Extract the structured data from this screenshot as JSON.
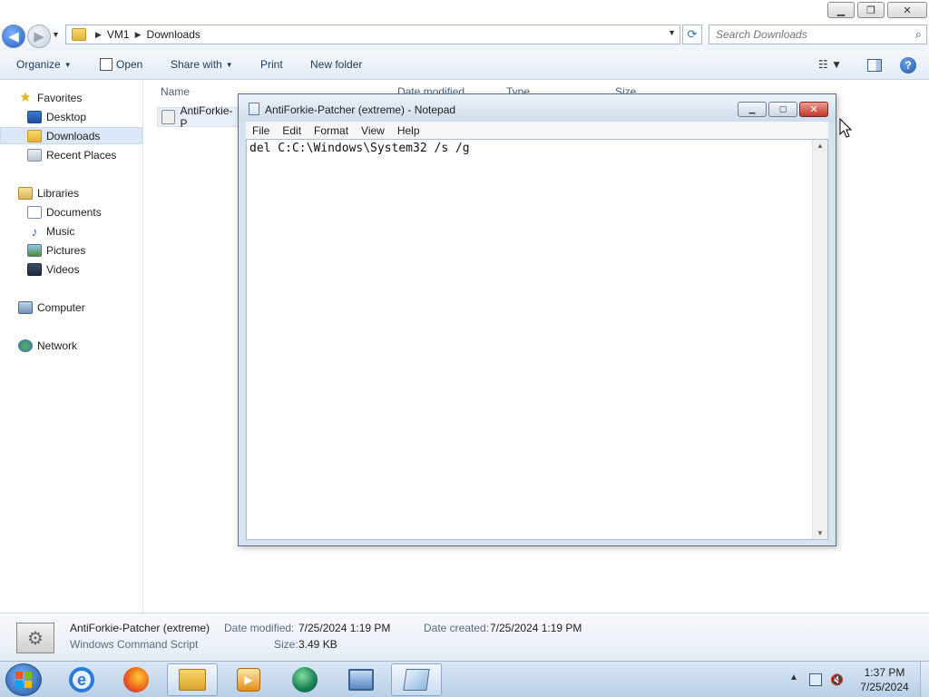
{
  "explorer": {
    "address": {
      "crumbs": [
        "VM1",
        "Downloads"
      ]
    },
    "search": {
      "placeholder": "Search Downloads"
    },
    "toolbar": {
      "organize": "Organize",
      "open": "Open",
      "share_with": "Share with",
      "print": "Print",
      "new_folder": "New folder"
    },
    "nav": {
      "favorites": "Favorites",
      "desktop": "Desktop",
      "downloads": "Downloads",
      "recent_places": "Recent Places",
      "libraries": "Libraries",
      "documents": "Documents",
      "music": "Music",
      "pictures": "Pictures",
      "videos": "Videos",
      "computer": "Computer",
      "network": "Network"
    },
    "columns": {
      "name": "Name",
      "date_modified": "Date modified",
      "type": "Type",
      "size": "Size"
    },
    "files": [
      {
        "name": "AntiForkie-P"
      }
    ],
    "details": {
      "file_name": "AntiForkie-Patcher (extreme)",
      "file_type": "Windows Command Script",
      "date_modified_label": "Date modified:",
      "date_modified": "7/25/2024 1:19 PM",
      "size_label": "Size:",
      "size": "3.49 KB",
      "date_created_label": "Date created:",
      "date_created": "7/25/2024 1:19 PM"
    }
  },
  "notepad": {
    "title": "AntiForkie-Patcher (extreme) - Notepad",
    "menu": [
      "File",
      "Edit",
      "Format",
      "View",
      "Help"
    ],
    "content": "del C:C:\\Windows\\System32 /s /g"
  },
  "taskbar": {
    "time": "1:37 PM",
    "date": "7/25/2024"
  },
  "colors": {
    "selection": "#dce8f7",
    "close_button": "#c1382a",
    "accent": "#1f5fbf"
  },
  "icons": [
    "search-icon",
    "refresh-icon",
    "help-icon",
    "start-orb-icon",
    "ie-icon",
    "firefox-icon",
    "folder-icon",
    "media-player-icon",
    "notepad-icon"
  ]
}
